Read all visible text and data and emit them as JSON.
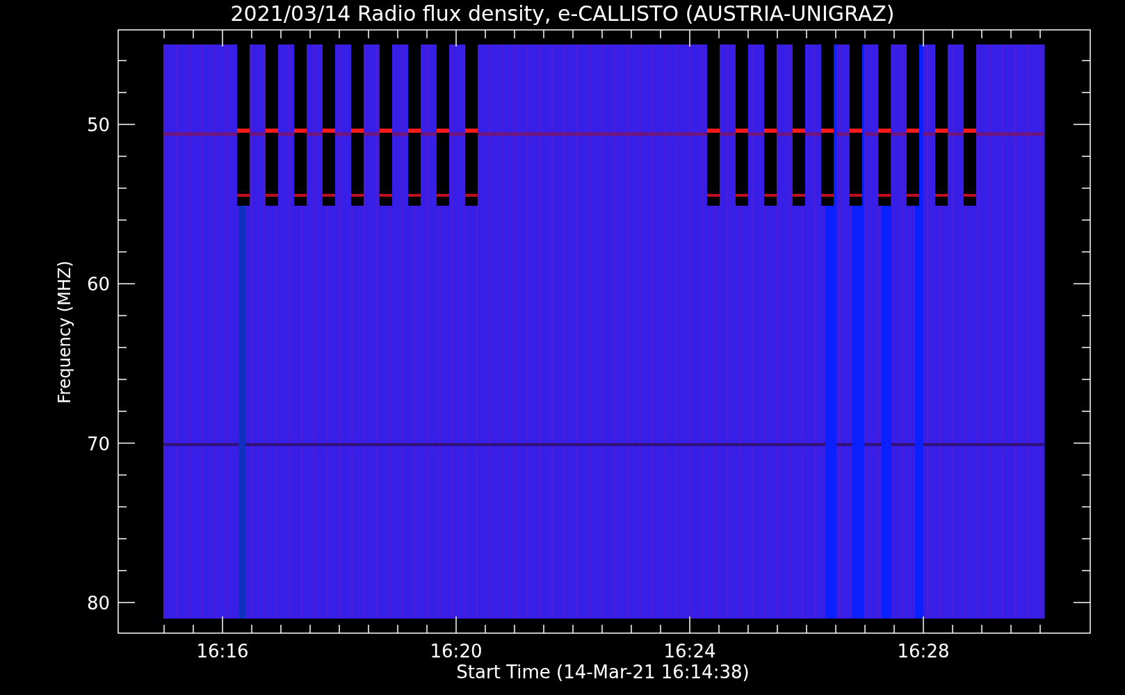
{
  "title": "2021/03/14  Radio flux density, e-CALLISTO (AUSTRIA-UNIGRAZ)",
  "ylabel": "Frequency (MHZ)",
  "xlabel": "Start Time (14-Mar-21 16:14:38)",
  "yticks": [
    "50",
    "60",
    "70",
    "80"
  ],
  "xticks": [
    "16:16",
    "16:20",
    "16:24",
    "16:28"
  ]
}
